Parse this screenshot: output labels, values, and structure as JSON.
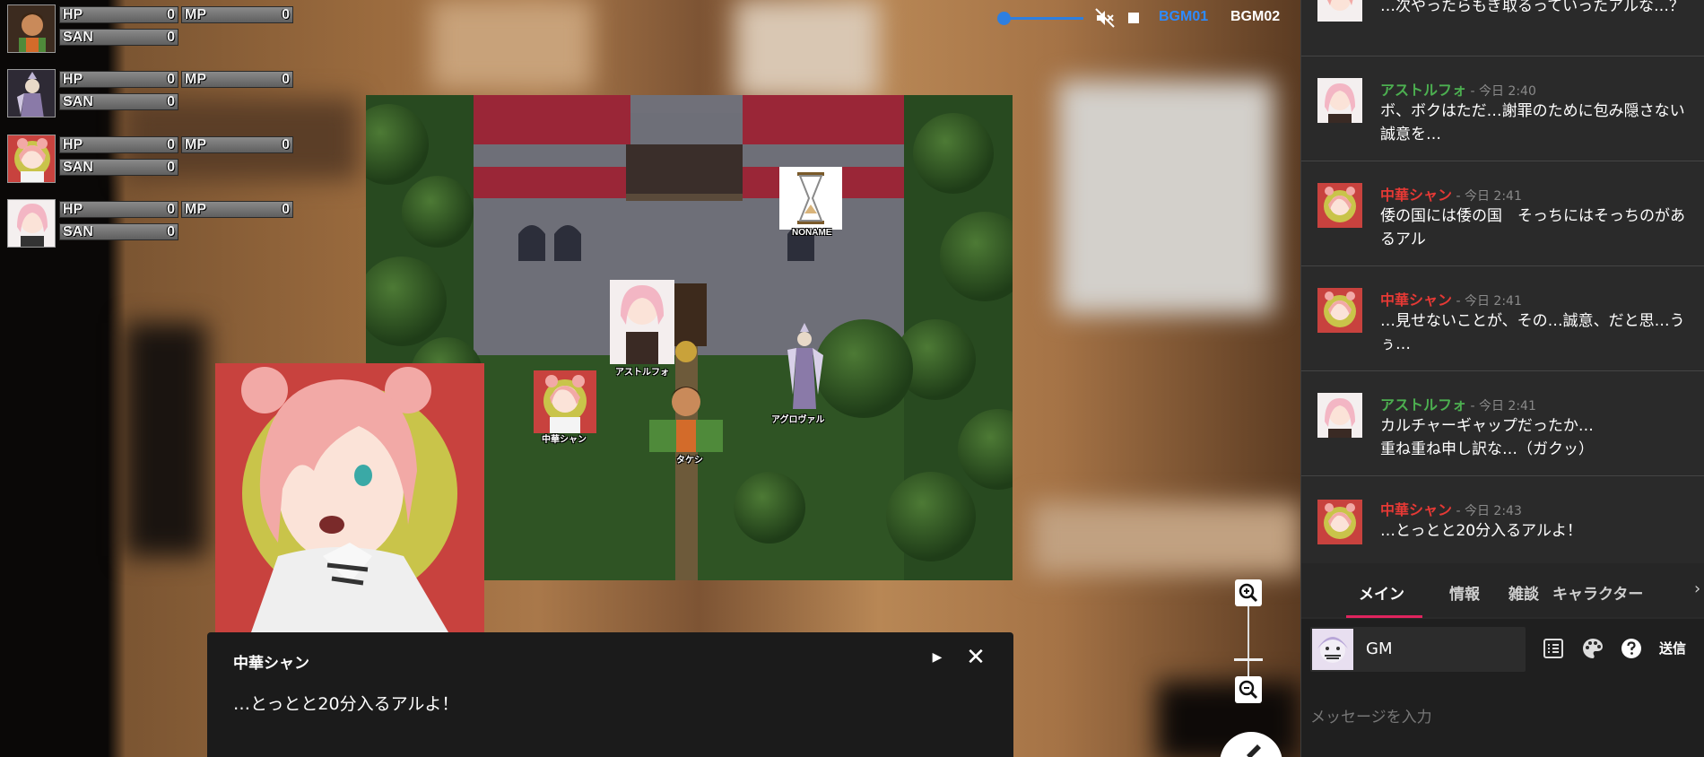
{
  "status_panel": {
    "rows": [
      {
        "hp_label": "HP",
        "hp_value": "0",
        "mp_label": "MP",
        "mp_value": "0",
        "san_label": "SAN",
        "san_value": "0",
        "avatar": "brown-haired-man-portrait"
      },
      {
        "hp_label": "HP",
        "hp_value": "0",
        "mp_label": "MP",
        "mp_value": "0",
        "san_label": "SAN",
        "san_value": "0",
        "avatar": "knight-portrait"
      },
      {
        "hp_label": "HP",
        "hp_value": "0",
        "mp_label": "MP",
        "mp_value": "0",
        "san_label": "SAN",
        "san_value": "0",
        "avatar": "pink-hair-girl-portrait"
      },
      {
        "hp_label": "HP",
        "hp_value": "0",
        "mp_label": "MP",
        "mp_value": "0",
        "san_label": "SAN",
        "san_value": "0",
        "avatar": "pink-hair-boy-portrait"
      }
    ]
  },
  "audio_bar": {
    "bgm1": "BGM01",
    "bgm2": "BGM02",
    "accent_color": "#2e8bff"
  },
  "map": {
    "pieces": {
      "noname": "NONAME",
      "astolfo": "アストルフォ",
      "chinese_shan": "中華シャン",
      "takeshi": "タケシ",
      "agravain": "アグロヴァル"
    }
  },
  "dialog": {
    "speaker": "中華シャン",
    "text": "…とっとと20分入るアルよ！"
  },
  "chat": {
    "messages": [
      {
        "name": "",
        "time": "",
        "text": "…次やったらもぎ取るっていったアルな…？",
        "color": "#ffffff",
        "avatar": "pink-hair-girl-avatar"
      },
      {
        "name": "アストルフォ",
        "time": " - 今日 2:40",
        "text": "ボ、ボクはただ…謝罪のために包み隠さない誠意を…",
        "color": "#4caf50",
        "avatar": "pink-hair-boy-avatar"
      },
      {
        "name": "中華シャン",
        "time": " - 今日 2:41",
        "text": "倭の国には倭の国　そっちにはそっちのがあるアル",
        "color": "#e53935",
        "avatar": "pink-hair-girl-avatar"
      },
      {
        "name": "中華シャン",
        "time": " - 今日 2:41",
        "text": "…見せないことが、その…誠意、だと思…うぅ…",
        "color": "#e53935",
        "avatar": "pink-hair-girl-avatar"
      },
      {
        "name": "アストルフォ",
        "time": " - 今日 2:41",
        "text": "カルチャーギャップだったか…\n重ね重ね申し訳な…（ガクッ）",
        "color": "#4caf50",
        "avatar": "pink-hair-boy-avatar"
      },
      {
        "name": "中華シャン",
        "time": " - 今日 2:43",
        "text": "…とっとと20分入るアルよ！",
        "color": "#e53935",
        "avatar": "pink-hair-girl-avatar"
      }
    ],
    "tabs": [
      "メイン",
      "情報",
      "雑談",
      "キャラクター"
    ],
    "active_tab_color": "#e0245e",
    "sender_name": "GM",
    "send_label": "送信",
    "input_placeholder": "メッセージを入力"
  }
}
